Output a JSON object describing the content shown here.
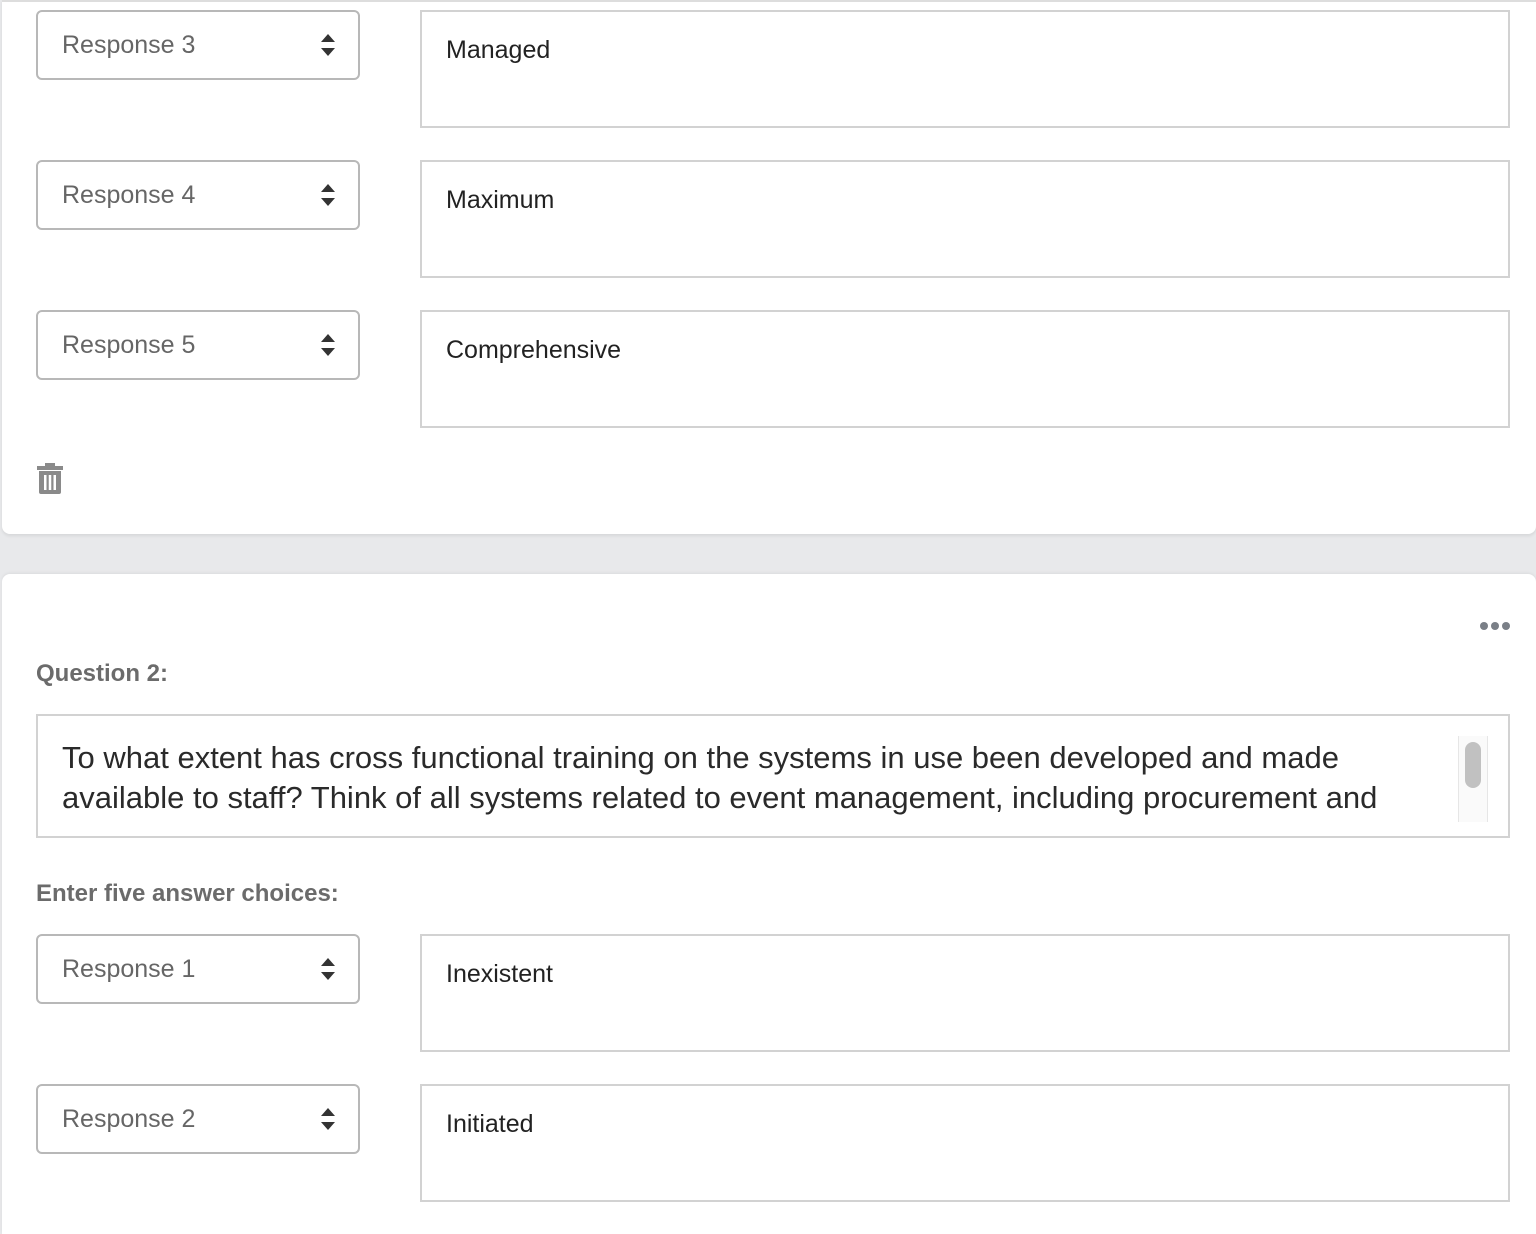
{
  "question1": {
    "rows": [
      {
        "response": "Response 3",
        "answer": "Managed"
      },
      {
        "response": "Response 4",
        "answer": "Maximum"
      },
      {
        "response": "Response 5",
        "answer": "Comprehensive"
      }
    ],
    "delete_icon": "trash-icon"
  },
  "question2": {
    "title": "Question 2:",
    "menu_icon": "more-horizontal-icon",
    "text": "To what extent has cross functional training on the systems in use been developed and made available to staff? Think of all systems related to event management, including procurement and",
    "choices_label": "Enter five answer choices:",
    "rows": [
      {
        "response": "Response 1",
        "answer": "Inexistent"
      },
      {
        "response": "Response 2",
        "answer": "Initiated"
      }
    ]
  },
  "colors": {
    "background": "#e8e9eb",
    "card": "#ffffff",
    "border": "#d2d2d2",
    "label": "#6b6b6b"
  }
}
